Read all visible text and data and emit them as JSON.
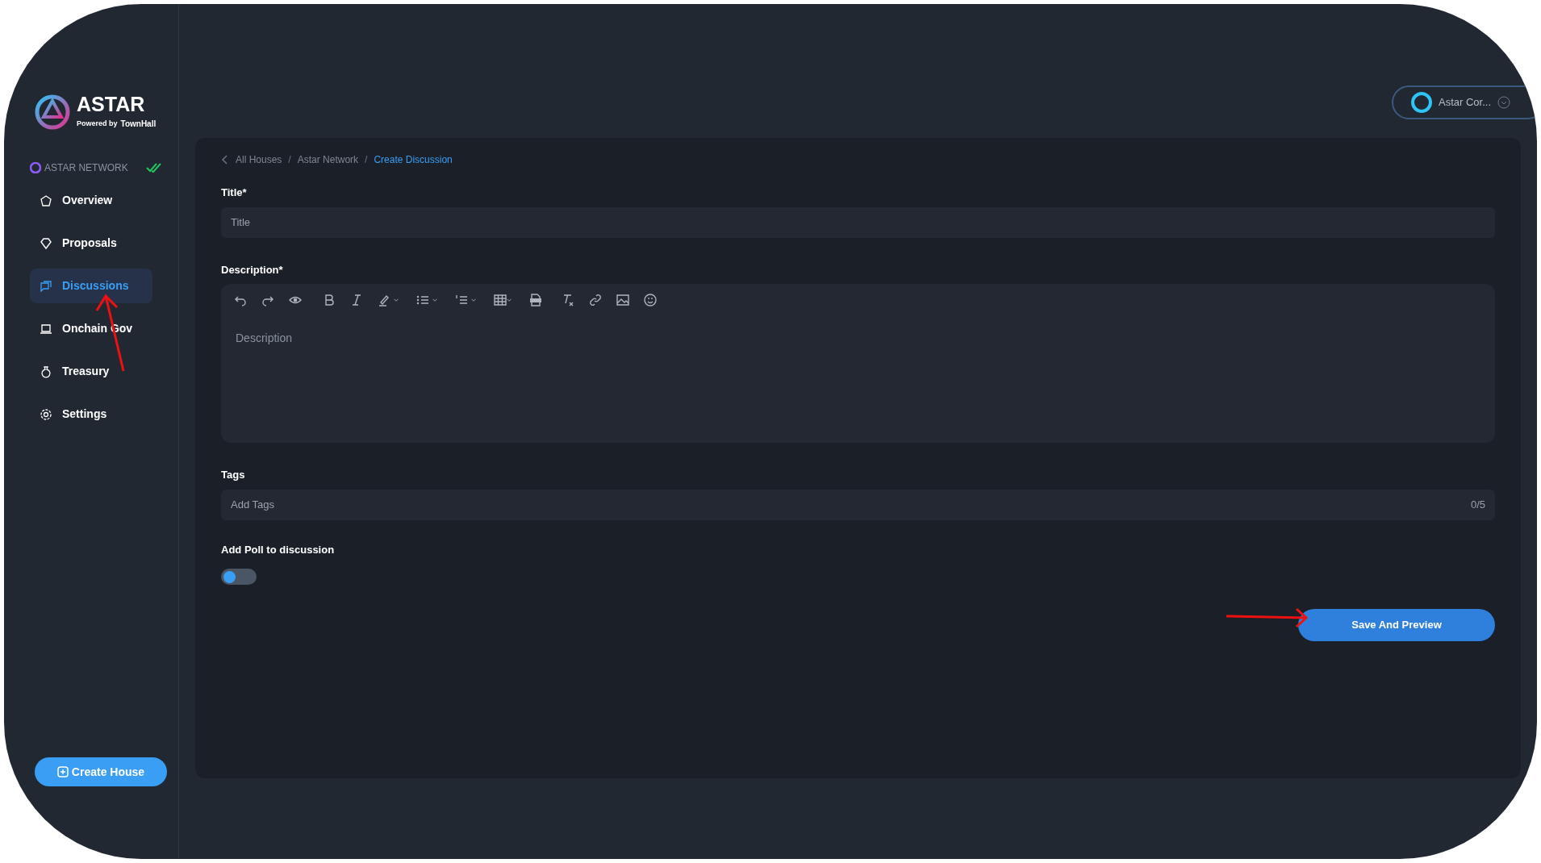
{
  "brand": {
    "name": "ASTAR",
    "powered_by": "Powered by",
    "platform": "TownHall"
  },
  "house": {
    "name": "ASTAR NETWORK",
    "verified": true
  },
  "nav": [
    {
      "label": "Overview",
      "selected": false
    },
    {
      "label": "Proposals",
      "selected": false
    },
    {
      "label": "Discussions",
      "selected": true
    },
    {
      "label": "Onchain Gov",
      "selected": false
    },
    {
      "label": "Treasury",
      "selected": false
    },
    {
      "label": "Settings",
      "selected": false
    }
  ],
  "create_button": "Create House",
  "account": {
    "name": "Astar Cor..."
  },
  "breadcrumb": [
    {
      "kind": "link",
      "label": "All Houses",
      "selected": false
    },
    {
      "kind": "separator",
      "label": "/"
    },
    {
      "kind": "link",
      "label": "Astar Network",
      "selected": false
    },
    {
      "kind": "separator",
      "label": "/"
    },
    {
      "kind": "link",
      "label": "Create Discussion",
      "selected": true
    }
  ],
  "form": {
    "title": {
      "label": "Title*",
      "placeholder": "Title"
    },
    "description": {
      "label": "Description*",
      "placeholder": "Description"
    },
    "tags": {
      "label": "Tags",
      "placeholder": "Add Tags",
      "count": "0/5"
    },
    "poll": {
      "label": "Add Poll to discussion",
      "on": false
    },
    "submit": "Save And Preview"
  }
}
